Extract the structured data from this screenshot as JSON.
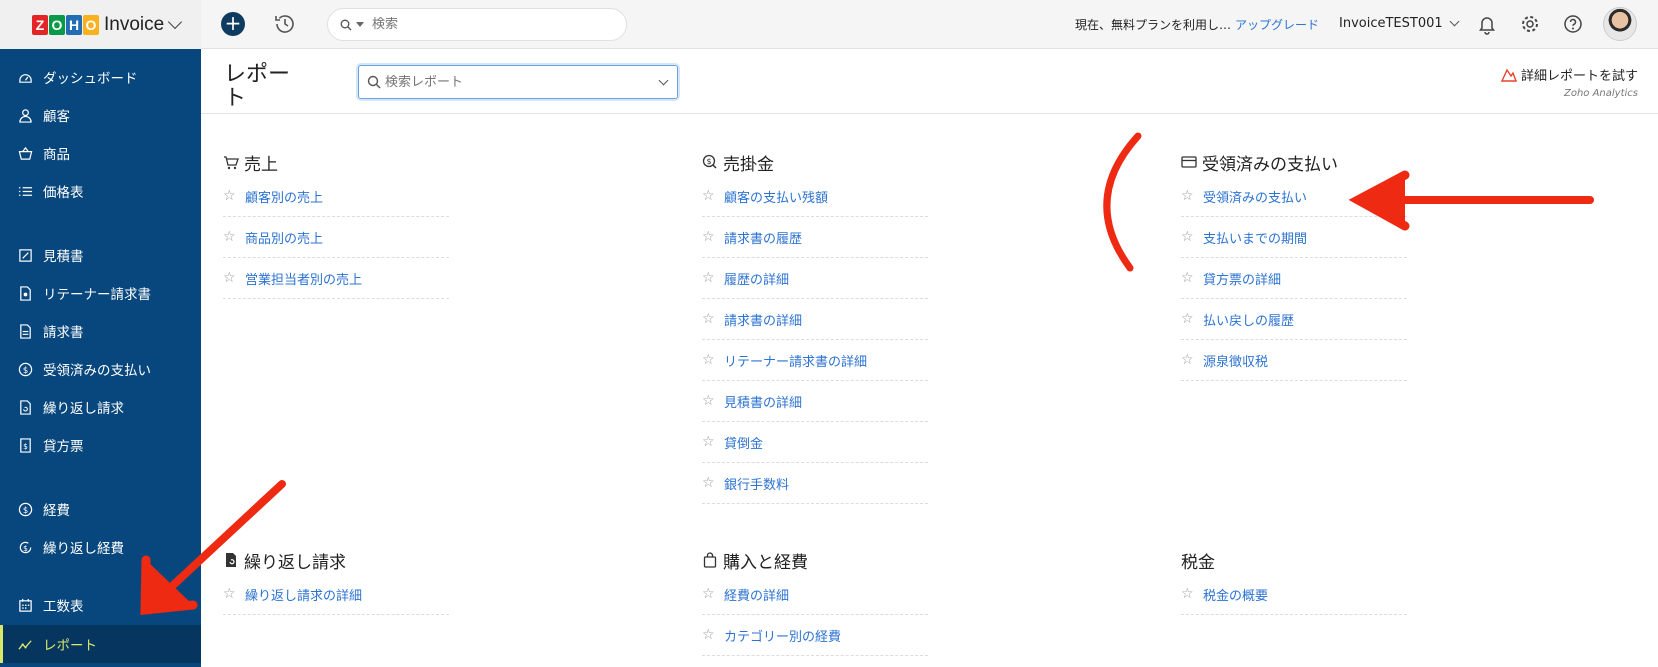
{
  "brand": {
    "logo_letters": [
      "Z",
      "O",
      "H",
      "O"
    ],
    "logo_colors": [
      "#e42527",
      "#089949",
      "#226db4",
      "#f9b21d"
    ],
    "name": "Invoice"
  },
  "topbar": {
    "search_placeholder": "検索",
    "plan_text": "現在、無料プランを利用し…",
    "upgrade_label": "アップグレード",
    "org_name": "InvoiceTEST001"
  },
  "sidebar": {
    "items": [
      {
        "label": "ダッシュボード",
        "icon": "dashboard-icon"
      },
      {
        "label": "顧客",
        "icon": "user-icon"
      },
      {
        "label": "商品",
        "icon": "basket-icon"
      },
      {
        "label": "価格表",
        "icon": "list-icon"
      },
      {
        "label": "見積書",
        "icon": "estimate-icon"
      },
      {
        "label": "リテーナー請求書",
        "icon": "retainer-icon"
      },
      {
        "label": "請求書",
        "icon": "invoice-icon"
      },
      {
        "label": "受領済みの支払い",
        "icon": "payment-icon"
      },
      {
        "label": "繰り返し請求",
        "icon": "recurring-invoice-icon"
      },
      {
        "label": "貸方票",
        "icon": "credit-note-icon"
      },
      {
        "label": "経費",
        "icon": "expense-icon"
      },
      {
        "label": "繰り返し経費",
        "icon": "recurring-expense-icon"
      },
      {
        "label": "工数表",
        "icon": "timesheet-icon"
      },
      {
        "label": "レポート",
        "icon": "reports-icon",
        "active": true
      }
    ]
  },
  "main": {
    "title": "レポート",
    "report_search_placeholder": "検索レポート",
    "analytics_label": "詳細レポートを試す",
    "analytics_sub": "Zoho Analytics",
    "sections": [
      {
        "title": "売上",
        "icon": "cart-icon",
        "items": [
          "顧客別の売上",
          "商品別の売上",
          "営業担当者別の売上"
        ]
      },
      {
        "title": "売掛金",
        "icon": "receivable-icon",
        "items": [
          "顧客の支払い残額",
          "請求書の履歴",
          "履歴の詳細",
          "請求書の詳細",
          "リテーナー請求書の詳細",
          "見積書の詳細",
          "貸倒金",
          "銀行手数料"
        ]
      },
      {
        "title": "受領済みの支払い",
        "icon": "card-icon",
        "items": [
          "受領済みの支払い",
          "支払いまでの期間",
          "貸方票の詳細",
          "払い戻しの履歴",
          "源泉徴収税"
        ]
      },
      {
        "title": "繰り返し請求",
        "icon": "recurring-icon",
        "items": [
          "繰り返し請求の詳細"
        ]
      },
      {
        "title": "購入と経費",
        "icon": "bag-icon",
        "items": [
          "経費の詳細",
          "カテゴリー別の経費"
        ]
      },
      {
        "title": "税金",
        "icon": "",
        "items": [
          "税金の概要"
        ]
      }
    ]
  },
  "colors": {
    "sidebar": "#08477d",
    "link": "#2c73d2",
    "active": "#d8e96a",
    "annotation": "#ee2a12"
  }
}
